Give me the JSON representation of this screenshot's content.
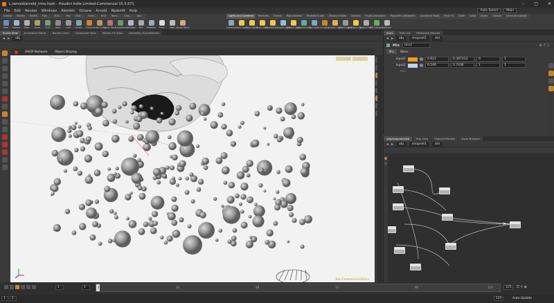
{
  "window": {
    "title": "L:/arnold/arnold_intro.hiplc - Houdini Indie Limited-Commercial 15.5.671",
    "controls": [
      "–",
      "▢",
      "✕"
    ]
  },
  "menu": {
    "items": [
      "File",
      "Edit",
      "Render",
      "Windows",
      "Alembic",
      "Octane",
      "Arnold",
      "Redshift",
      "Help"
    ],
    "desktop": "Auto Select",
    "workspace": "Main"
  },
  "shelf": {
    "tabs_left": [
      "Create",
      "Modify",
      "Model",
      "Poly...",
      "Text...",
      "Rig",
      "Char...",
      "Guid...",
      "Hair",
      "Term...",
      "Clou...",
      "Vol..."
    ],
    "tools_left": [
      "Box",
      "Sphere",
      "Tube",
      "Torus",
      "Grid",
      "Null",
      "Line",
      "Circle",
      "Curve",
      "Draw Curve",
      "Spray Paint",
      "L-System",
      "Metaball",
      "File",
      "Platonic",
      "Font",
      "Path",
      "Spray Paint"
    ],
    "tabs_right": [
      "Lights and Cameras",
      "Particles",
      "Grains",
      "Rigid Bodies",
      "Particle Fluids",
      "Viscous Fluids",
      "Oceans",
      "Fluid Containers",
      "Populate Containers",
      "Container Tools",
      "Pyro FX",
      "Cloth",
      "Solid",
      "Wires",
      "Crowds",
      "Drive Simulation"
    ],
    "active_tab_right": "Lights and Cameras",
    "tools_right": [
      "Camera",
      "Point Light",
      "Spot Light",
      "Area Light",
      "Geometry L...",
      "Volume Light",
      "Distant Light",
      "Environment",
      "Sky Light",
      "GI Light",
      "Caustic Light",
      "Portal Light",
      "Ambient Lig...",
      "Stereo Cam",
      "VR Camera",
      "Switcher"
    ]
  },
  "viewer": {
    "pane_tabs": [
      "Scene View",
      "Animation Editor",
      "Render View",
      "Composite View",
      "Motion FX View",
      "Geometry Spreadsheet"
    ],
    "path": "obj",
    "header": [
      "SHOP Network",
      "Object Display"
    ],
    "footer_label": "Non-Commercial Edition"
  },
  "params": {
    "pane_tabs": [
      "mix1",
      "Tree List",
      "Reference Monitor"
    ],
    "path": [
      "obj",
      "shopnet1",
      "std"
    ],
    "node_type": "Mix",
    "node_name": "mix2",
    "tabs": [
      "Mix",
      "Notes"
    ],
    "rows": [
      {
        "label": "input1",
        "color": "#f59a1a",
        "values": [
          "0.922",
          "0.387333",
          "0",
          "1"
        ]
      },
      {
        "label": "input2",
        "color": "#b8d2f0",
        "values": [
          "0.546",
          "0.7036",
          "1",
          "1"
        ]
      },
      {
        "label": "mix",
        "color": "",
        "values": [
          "",
          "",
          "",
          ""
        ]
      }
    ]
  },
  "network": {
    "pane_tabs": [
      "/obj/shopnet1/std",
      "Tree View",
      "Material Palette",
      "Asset Browser"
    ],
    "path": [
      "obj",
      "shopnet1",
      "std"
    ]
  },
  "timeline": {
    "frame": "1",
    "start": "1",
    "end": "1",
    "ticks": [
      "1",
      "24",
      "48",
      "72",
      "96",
      "120"
    ],
    "end_frame": "125",
    "end_frame2": "125"
  },
  "status": {
    "auto_update": "Auto Update"
  },
  "colors": {
    "accent_orange": "#f59a1a",
    "viewport_bg": "#f2f2f2",
    "panel_bg": "#3a3a3a"
  }
}
